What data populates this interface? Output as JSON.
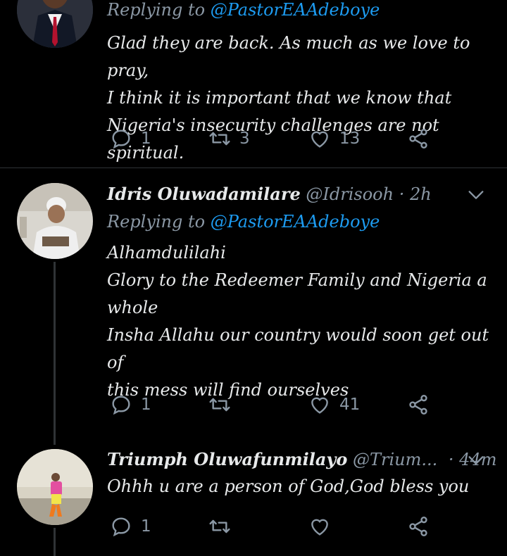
{
  "tweets": [
    {
      "name": "",
      "handle": "",
      "time": "",
      "replying_label": "Replying to",
      "replying_mention": "@PastorEAAdeboye",
      "lines": [
        "Glad they are back. As much as we love to pray,",
        "I think it is important that we know that",
        "Nigeria's insecurity challenges are not spiritual."
      ],
      "reply_count": "1",
      "retweet_count": "3",
      "like_count": "13"
    },
    {
      "name": "Idris Oluwadamilare",
      "handle": "@Idrisooh",
      "dot": "·",
      "time": "2h",
      "replying_label": "Replying to",
      "replying_mention": "@PastorEAAdeboye",
      "lines": [
        "Alhamdulilahi",
        "Glory to the Redeemer Family and Nigeria a",
        "whole",
        "Insha Allahu our country would soon get out of",
        "this mess will find ourselves"
      ],
      "reply_count": "1",
      "retweet_count": "",
      "like_count": "41"
    },
    {
      "name": "Triumph Oluwafunmilayo",
      "handle": "@Trium...",
      "dot": "·",
      "time": "44m",
      "lines": [
        "Ohhh u are a person of God,God bless you"
      ],
      "reply_count": "1",
      "retweet_count": "",
      "like_count": ""
    }
  ],
  "icons": {
    "reply": "reply-icon",
    "retweet": "retweet-icon",
    "like": "heart-icon",
    "share": "share-icon",
    "more": "chevron-down-icon"
  },
  "colors": {
    "background": "#000000",
    "text": "#e7e9ea",
    "secondary": "#8b98a5",
    "accent": "#1d9bf0"
  }
}
